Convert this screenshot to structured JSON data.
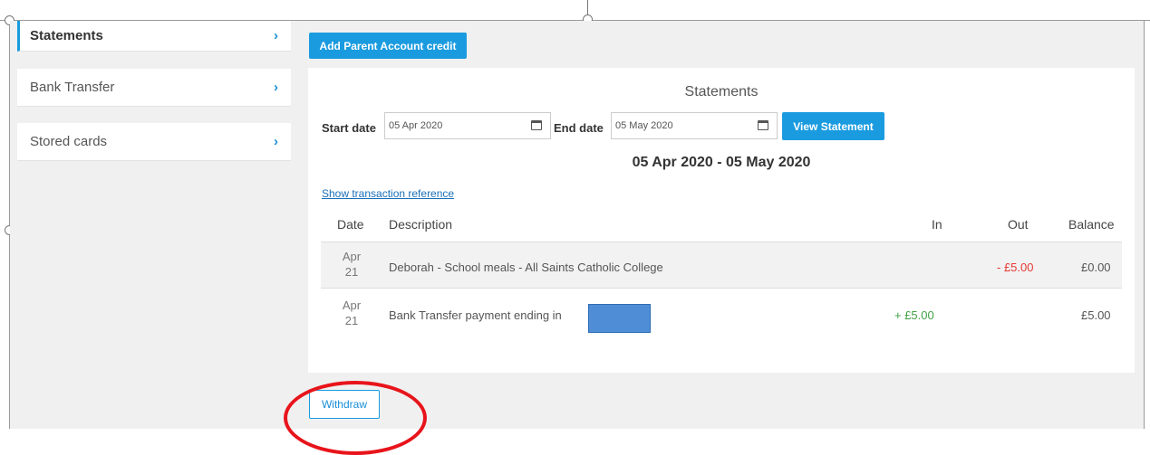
{
  "sidebar": {
    "items": [
      {
        "label": "Statements",
        "active": true
      },
      {
        "label": "Bank Transfer",
        "active": false
      },
      {
        "label": "Stored cards",
        "active": false
      }
    ]
  },
  "actions": {
    "add_credit_label": "Add Parent Account credit",
    "withdraw_label": "Withdraw"
  },
  "statements": {
    "title": "Statements",
    "start_label": "Start date",
    "start_value": "05 Apr 2020",
    "end_label": "End date",
    "end_value": "05 May 2020",
    "view_label": "View Statement",
    "range_title": "05 Apr 2020 - 05 May 2020",
    "show_ref_label": "Show transaction reference",
    "columns": {
      "date": "Date",
      "description": "Description",
      "in": "In",
      "out": "Out",
      "balance": "Balance"
    },
    "rows": [
      {
        "month": "Apr",
        "day": "21",
        "description": "Deborah - School meals - All Saints Catholic College",
        "in": "",
        "out": "- £5.00",
        "balance": "£0.00"
      },
      {
        "month": "Apr",
        "day": "21",
        "description": "Bank Transfer payment ending in",
        "in": "+ £5.00",
        "out": "",
        "balance": "£5.00"
      }
    ]
  },
  "colors": {
    "accent": "#1a9be0",
    "negative": "#e53935",
    "positive": "#43a047",
    "annotation": "#e8141b"
  }
}
